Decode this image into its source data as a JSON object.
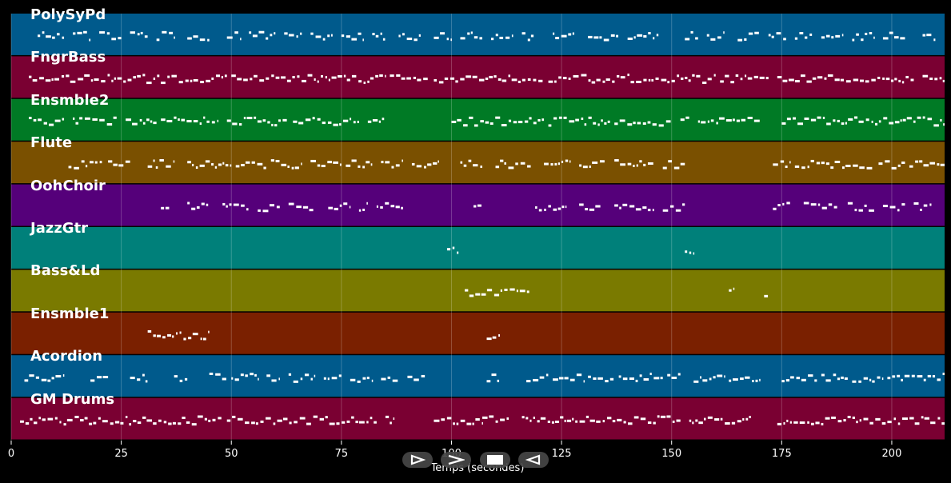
{
  "colors": {
    "background": "#000000",
    "note": "#ffffff",
    "grid": "#ffffff"
  },
  "controls": [
    {
      "name": "play-icon",
      "glyph": "play-outline"
    },
    {
      "name": "forward-icon",
      "glyph": "chevron-right"
    },
    {
      "name": "stop-icon",
      "glyph": "square"
    },
    {
      "name": "back-icon",
      "glyph": "play-outline-left"
    }
  ],
  "chart_data": {
    "type": "piano-roll",
    "xlabel": "Temps (secondes)",
    "xlim": [
      0,
      212
    ],
    "xticks": [
      "0",
      "25",
      "50",
      "75",
      "100",
      "125",
      "150",
      "175",
      "200"
    ],
    "grid": true,
    "tracks": [
      {
        "name": "PolySyPd",
        "color": "#005a8c",
        "segments": [
          [
            6,
            12
          ],
          [
            14,
            18
          ],
          [
            20,
            25
          ],
          [
            27,
            31
          ],
          [
            33,
            37
          ],
          [
            40,
            45
          ],
          [
            49,
            52
          ],
          [
            54,
            60
          ],
          [
            62,
            66
          ],
          [
            68,
            73
          ],
          [
            75,
            80
          ],
          [
            82,
            85
          ],
          [
            88,
            93
          ],
          [
            96,
            100
          ],
          [
            102,
            107
          ],
          [
            109,
            114
          ],
          [
            116,
            119
          ],
          [
            123,
            128
          ],
          [
            131,
            138
          ],
          [
            140,
            147
          ],
          [
            153,
            156
          ],
          [
            158,
            162
          ],
          [
            165,
            170
          ],
          [
            172,
            176
          ],
          [
            178,
            182
          ],
          [
            184,
            189
          ],
          [
            191,
            196
          ],
          [
            198,
            203
          ],
          [
            207,
            210
          ]
        ]
      },
      {
        "name": "FngrBass",
        "color": "#7a0032",
        "segments": [
          [
            4,
            49
          ],
          [
            50,
            85
          ],
          [
            86,
            95
          ],
          [
            96,
            121
          ],
          [
            122,
            160
          ],
          [
            161,
            172
          ],
          [
            174,
            205
          ],
          [
            207,
            212
          ]
        ]
      },
      {
        "name": "Ensmble2",
        "color": "#007a25",
        "segments": [
          [
            4,
            12
          ],
          [
            14,
            24
          ],
          [
            26,
            33
          ],
          [
            34,
            47
          ],
          [
            49,
            63
          ],
          [
            64,
            79
          ],
          [
            81,
            85
          ],
          [
            100,
            121
          ],
          [
            122,
            136
          ],
          [
            137,
            150
          ],
          [
            152,
            154
          ],
          [
            156,
            170
          ],
          [
            175,
            212
          ]
        ]
      },
      {
        "name": "Flute",
        "color": "#7a5000",
        "segments": [
          [
            13,
            21
          ],
          [
            22,
            27
          ],
          [
            31,
            37
          ],
          [
            40,
            50
          ],
          [
            51,
            58
          ],
          [
            59,
            66
          ],
          [
            68,
            75
          ],
          [
            76,
            82
          ],
          [
            84,
            89
          ],
          [
            91,
            97
          ],
          [
            102,
            107
          ],
          [
            110,
            118
          ],
          [
            121,
            127
          ],
          [
            129,
            135
          ],
          [
            137,
            146
          ],
          [
            148,
            153
          ],
          [
            173,
            177
          ],
          [
            178,
            196
          ],
          [
            197,
            203
          ],
          [
            204,
            212
          ]
        ]
      },
      {
        "name": "OohChoir",
        "color": "#55007a",
        "segments": [
          [
            34,
            36
          ],
          [
            40,
            45
          ],
          [
            48,
            54
          ],
          [
            56,
            61
          ],
          [
            63,
            69
          ],
          [
            72,
            77
          ],
          [
            79,
            81
          ],
          [
            83,
            89
          ],
          [
            105,
            107
          ],
          [
            119,
            126
          ],
          [
            129,
            134
          ],
          [
            137,
            146
          ],
          [
            148,
            153
          ],
          [
            173,
            177
          ],
          [
            180,
            188
          ],
          [
            190,
            196
          ],
          [
            198,
            203
          ],
          [
            205,
            209
          ]
        ]
      },
      {
        "name": "JazzGtr",
        "color": "#00807a",
        "segments": [
          [
            99,
            102
          ],
          [
            153,
            155
          ]
        ]
      },
      {
        "name": "Bass&Ld",
        "color": "#7a7a00",
        "segments": [
          [
            103,
            118
          ],
          [
            163,
            164
          ],
          [
            171,
            172
          ]
        ]
      },
      {
        "name": "Ensmble1",
        "color": "#7a2000",
        "segments": [
          [
            31,
            45
          ],
          [
            108,
            111
          ]
        ]
      },
      {
        "name": "Acordion",
        "color": "#005a8c",
        "segments": [
          [
            3,
            12
          ],
          [
            18,
            22
          ],
          [
            27,
            31
          ],
          [
            37,
            40
          ],
          [
            45,
            49
          ],
          [
            50,
            56
          ],
          [
            58,
            61
          ],
          [
            63,
            69
          ],
          [
            71,
            75
          ],
          [
            77,
            82
          ],
          [
            84,
            88
          ],
          [
            90,
            94
          ],
          [
            108,
            111
          ],
          [
            117,
            122
          ],
          [
            123,
            130
          ],
          [
            131,
            137
          ],
          [
            138,
            148
          ],
          [
            149,
            152
          ],
          [
            155,
            162
          ],
          [
            163,
            170
          ],
          [
            175,
            183
          ],
          [
            184,
            190
          ],
          [
            191,
            198
          ],
          [
            199,
            212
          ]
        ]
      },
      {
        "name": "GM Drums",
        "color": "#7a0032",
        "segments": [
          [
            2,
            48
          ],
          [
            49,
            83
          ],
          [
            85,
            87
          ],
          [
            96,
            107
          ],
          [
            107,
            113
          ],
          [
            116,
            152
          ],
          [
            154,
            168
          ],
          [
            174,
            212
          ]
        ]
      }
    ]
  }
}
